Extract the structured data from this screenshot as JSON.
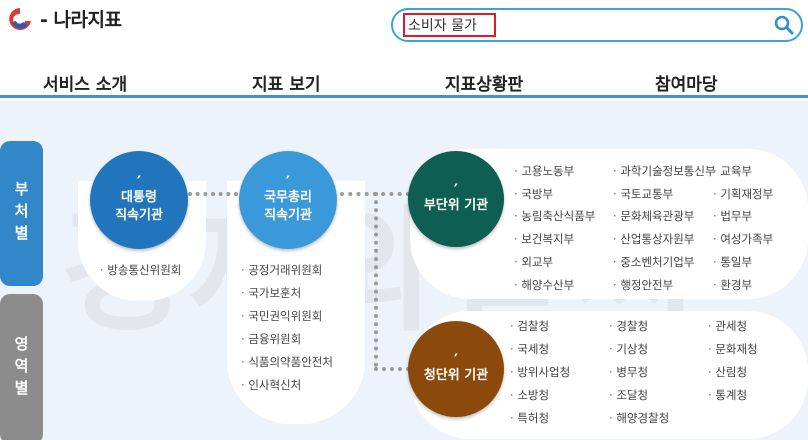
{
  "header": {
    "site_title": "- 나라지표",
    "search": {
      "value": "소비자 물가"
    }
  },
  "nav": {
    "items": [
      {
        "label": "서비스 소개"
      },
      {
        "label": "지표 보기"
      },
      {
        "label": "지표상황판"
      },
      {
        "label": "참여마당"
      }
    ]
  },
  "side_tabs": {
    "active": "부처별",
    "inactive": "영역별"
  },
  "watermark": "경제와날씨",
  "groups": {
    "president": {
      "tick": "′",
      "line1": "대통령",
      "line2": "직속기관",
      "color": "#2175bd",
      "orgs": [
        "방송통신위원회"
      ]
    },
    "pm": {
      "tick": "′",
      "line1": "국무총리",
      "line2": "직속기관",
      "color": "#3a9ad9",
      "orgs": [
        "공정거래위원회",
        "국가보훈처",
        "국민권익위원회",
        "금융위원회",
        "식품의약품안전처",
        "인사혁신처"
      ]
    },
    "ministry": {
      "tick": "′",
      "line1": "부단위 기관",
      "color": "#0e5e51",
      "col1": [
        "고용노동부",
        "국방부",
        "농림축산식품부",
        "보건복지부",
        "외교부",
        "해양수산부"
      ],
      "col2": [
        "과학기술정보통신부",
        "국토교통부",
        "문화체육관광부",
        "산업통상자원부",
        "중소벤처기업부",
        "행정안전부"
      ],
      "col3": [
        "교육부",
        "기획재정부",
        "법무부",
        "여성가족부",
        "통일부",
        "환경부"
      ]
    },
    "agency": {
      "tick": "′",
      "line1": "청단위 기관",
      "color": "#8b4a0b",
      "col1": [
        "검찰청",
        "국세청",
        "방위사업청",
        "소방청",
        "특허청"
      ],
      "col2": [
        "경찰청",
        "기상청",
        "병무청",
        "조달청",
        "해양경찰청"
      ],
      "col3": [
        "관세청",
        "문화재청",
        "산림청",
        "통계청"
      ]
    }
  }
}
